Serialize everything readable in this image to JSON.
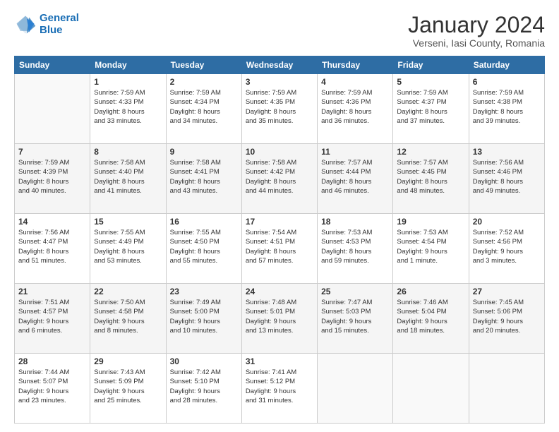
{
  "header": {
    "logo_line1": "General",
    "logo_line2": "Blue",
    "title": "January 2024",
    "subtitle": "Verseni, Iasi County, Romania"
  },
  "calendar": {
    "days_of_week": [
      "Sunday",
      "Monday",
      "Tuesday",
      "Wednesday",
      "Thursday",
      "Friday",
      "Saturday"
    ],
    "weeks": [
      [
        {
          "day": "",
          "info": ""
        },
        {
          "day": "1",
          "info": "Sunrise: 7:59 AM\nSunset: 4:33 PM\nDaylight: 8 hours\nand 33 minutes."
        },
        {
          "day": "2",
          "info": "Sunrise: 7:59 AM\nSunset: 4:34 PM\nDaylight: 8 hours\nand 34 minutes."
        },
        {
          "day": "3",
          "info": "Sunrise: 7:59 AM\nSunset: 4:35 PM\nDaylight: 8 hours\nand 35 minutes."
        },
        {
          "day": "4",
          "info": "Sunrise: 7:59 AM\nSunset: 4:36 PM\nDaylight: 8 hours\nand 36 minutes."
        },
        {
          "day": "5",
          "info": "Sunrise: 7:59 AM\nSunset: 4:37 PM\nDaylight: 8 hours\nand 37 minutes."
        },
        {
          "day": "6",
          "info": "Sunrise: 7:59 AM\nSunset: 4:38 PM\nDaylight: 8 hours\nand 39 minutes."
        }
      ],
      [
        {
          "day": "7",
          "info": "Sunrise: 7:59 AM\nSunset: 4:39 PM\nDaylight: 8 hours\nand 40 minutes."
        },
        {
          "day": "8",
          "info": "Sunrise: 7:58 AM\nSunset: 4:40 PM\nDaylight: 8 hours\nand 41 minutes."
        },
        {
          "day": "9",
          "info": "Sunrise: 7:58 AM\nSunset: 4:41 PM\nDaylight: 8 hours\nand 43 minutes."
        },
        {
          "day": "10",
          "info": "Sunrise: 7:58 AM\nSunset: 4:42 PM\nDaylight: 8 hours\nand 44 minutes."
        },
        {
          "day": "11",
          "info": "Sunrise: 7:57 AM\nSunset: 4:44 PM\nDaylight: 8 hours\nand 46 minutes."
        },
        {
          "day": "12",
          "info": "Sunrise: 7:57 AM\nSunset: 4:45 PM\nDaylight: 8 hours\nand 48 minutes."
        },
        {
          "day": "13",
          "info": "Sunrise: 7:56 AM\nSunset: 4:46 PM\nDaylight: 8 hours\nand 49 minutes."
        }
      ],
      [
        {
          "day": "14",
          "info": "Sunrise: 7:56 AM\nSunset: 4:47 PM\nDaylight: 8 hours\nand 51 minutes."
        },
        {
          "day": "15",
          "info": "Sunrise: 7:55 AM\nSunset: 4:49 PM\nDaylight: 8 hours\nand 53 minutes."
        },
        {
          "day": "16",
          "info": "Sunrise: 7:55 AM\nSunset: 4:50 PM\nDaylight: 8 hours\nand 55 minutes."
        },
        {
          "day": "17",
          "info": "Sunrise: 7:54 AM\nSunset: 4:51 PM\nDaylight: 8 hours\nand 57 minutes."
        },
        {
          "day": "18",
          "info": "Sunrise: 7:53 AM\nSunset: 4:53 PM\nDaylight: 8 hours\nand 59 minutes."
        },
        {
          "day": "19",
          "info": "Sunrise: 7:53 AM\nSunset: 4:54 PM\nDaylight: 9 hours\nand 1 minute."
        },
        {
          "day": "20",
          "info": "Sunrise: 7:52 AM\nSunset: 4:56 PM\nDaylight: 9 hours\nand 3 minutes."
        }
      ],
      [
        {
          "day": "21",
          "info": "Sunrise: 7:51 AM\nSunset: 4:57 PM\nDaylight: 9 hours\nand 6 minutes."
        },
        {
          "day": "22",
          "info": "Sunrise: 7:50 AM\nSunset: 4:58 PM\nDaylight: 9 hours\nand 8 minutes."
        },
        {
          "day": "23",
          "info": "Sunrise: 7:49 AM\nSunset: 5:00 PM\nDaylight: 9 hours\nand 10 minutes."
        },
        {
          "day": "24",
          "info": "Sunrise: 7:48 AM\nSunset: 5:01 PM\nDaylight: 9 hours\nand 13 minutes."
        },
        {
          "day": "25",
          "info": "Sunrise: 7:47 AM\nSunset: 5:03 PM\nDaylight: 9 hours\nand 15 minutes."
        },
        {
          "day": "26",
          "info": "Sunrise: 7:46 AM\nSunset: 5:04 PM\nDaylight: 9 hours\nand 18 minutes."
        },
        {
          "day": "27",
          "info": "Sunrise: 7:45 AM\nSunset: 5:06 PM\nDaylight: 9 hours\nand 20 minutes."
        }
      ],
      [
        {
          "day": "28",
          "info": "Sunrise: 7:44 AM\nSunset: 5:07 PM\nDaylight: 9 hours\nand 23 minutes."
        },
        {
          "day": "29",
          "info": "Sunrise: 7:43 AM\nSunset: 5:09 PM\nDaylight: 9 hours\nand 25 minutes."
        },
        {
          "day": "30",
          "info": "Sunrise: 7:42 AM\nSunset: 5:10 PM\nDaylight: 9 hours\nand 28 minutes."
        },
        {
          "day": "31",
          "info": "Sunrise: 7:41 AM\nSunset: 5:12 PM\nDaylight: 9 hours\nand 31 minutes."
        },
        {
          "day": "",
          "info": ""
        },
        {
          "day": "",
          "info": ""
        },
        {
          "day": "",
          "info": ""
        }
      ]
    ]
  }
}
